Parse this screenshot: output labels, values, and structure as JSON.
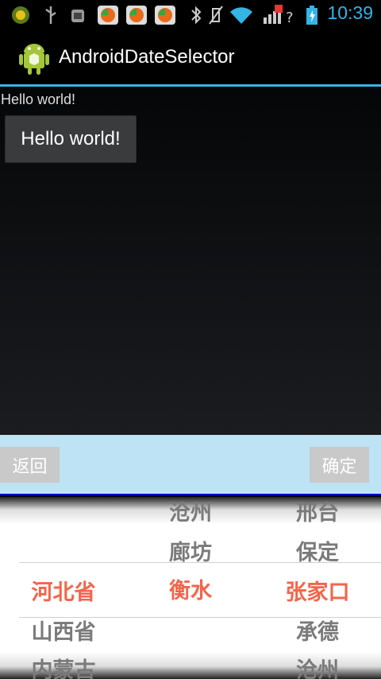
{
  "status_bar": {
    "time": "10:39"
  },
  "action_bar": {
    "title": "AndroidDateSelector"
  },
  "content": {
    "text": "Hello world!",
    "button_label": "Hello world!"
  },
  "picker": {
    "back_label": "返回",
    "ok_label": "确定",
    "province_col": [
      "",
      "",
      "河北省",
      "山西省",
      "内蒙古"
    ],
    "city_col": [
      "沧州",
      "廊坊",
      "衡水",
      "",
      ""
    ],
    "area_col": [
      "邢台",
      "保定",
      "张家口",
      "承德",
      "沧州"
    ]
  }
}
